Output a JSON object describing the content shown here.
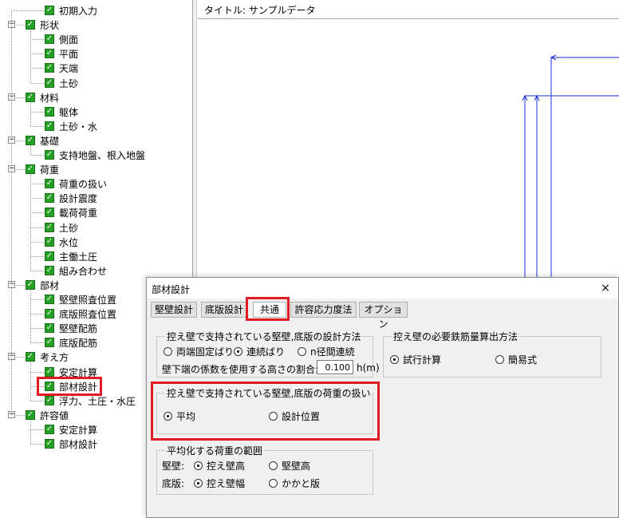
{
  "tree": {
    "items": [
      {
        "label": "初期入力",
        "level": 1
      },
      {
        "label": "形状",
        "level": 0
      },
      {
        "label": "側面",
        "level": 1
      },
      {
        "label": "平面",
        "level": 1
      },
      {
        "label": "天端",
        "level": 1
      },
      {
        "label": "土砂",
        "level": 1
      },
      {
        "label": "材料",
        "level": 0
      },
      {
        "label": "躯体",
        "level": 1
      },
      {
        "label": "土砂・水",
        "level": 1
      },
      {
        "label": "基礎",
        "level": 0
      },
      {
        "label": "支持地盤、根入地盤",
        "level": 1
      },
      {
        "label": "荷重",
        "level": 0
      },
      {
        "label": "荷重の扱い",
        "level": 1
      },
      {
        "label": "設計震度",
        "level": 1
      },
      {
        "label": "載荷荷重",
        "level": 1
      },
      {
        "label": "土砂",
        "level": 1
      },
      {
        "label": "水位",
        "level": 1
      },
      {
        "label": "主働土圧",
        "level": 1
      },
      {
        "label": "組み合わせ",
        "level": 1
      },
      {
        "label": "部材",
        "level": 0
      },
      {
        "label": "堅壁照査位置",
        "level": 1
      },
      {
        "label": "底版照査位置",
        "level": 1
      },
      {
        "label": "堅壁配筋",
        "level": 1
      },
      {
        "label": "底版配筋",
        "level": 1
      },
      {
        "label": "考え方",
        "level": 0
      },
      {
        "label": "安定計算",
        "level": 1
      },
      {
        "label": "部材設計",
        "level": 1
      },
      {
        "label": "浮力、土圧・水圧",
        "level": 1
      },
      {
        "label": "許容値",
        "level": 0
      },
      {
        "label": "安定計算",
        "level": 1
      },
      {
        "label": "部材設計",
        "level": 1
      }
    ]
  },
  "preview": {
    "title": "タイトル: サンプルデータ"
  },
  "dialog": {
    "title": "部材設計",
    "close": "×",
    "tabs": [
      "堅壁設計",
      "底版設計",
      "共通",
      "許容応力度法",
      "オプション"
    ],
    "active_tab": "共通",
    "design_method": {
      "legend": "控え壁で支持されている堅壁,底版の設計方法",
      "options": [
        "両端固定ばり",
        "連続ばり",
        "n径間連続"
      ],
      "selected": "連続ばり",
      "ratio_label": "壁下端の係数を使用する高さの割合:",
      "ratio_value": "0.100",
      "ratio_unit": "h(m)"
    },
    "rebar_method": {
      "legend": "控え壁の必要鉄筋量算出方法",
      "options": [
        "試行計算",
        "簡易式"
      ],
      "selected": "試行計算"
    },
    "load_handling": {
      "legend": "控え壁で支持されている堅壁,底版の荷重の扱い",
      "options": [
        "平均",
        "設計位置"
      ],
      "selected": "平均"
    },
    "averaging_range": {
      "legend": "平均化する荷重の範囲",
      "wall_label": "堅壁:",
      "wall_options": [
        "控え壁高",
        "堅壁高"
      ],
      "wall_selected": "控え壁高",
      "base_label": "底版:",
      "base_options": [
        "控え壁幅",
        "かかと版"
      ],
      "base_selected": "控え壁幅"
    }
  },
  "colors": {
    "highlight": "#e01b24",
    "checkbox": "#24a024",
    "drawing_line": "#1a2dd6"
  }
}
